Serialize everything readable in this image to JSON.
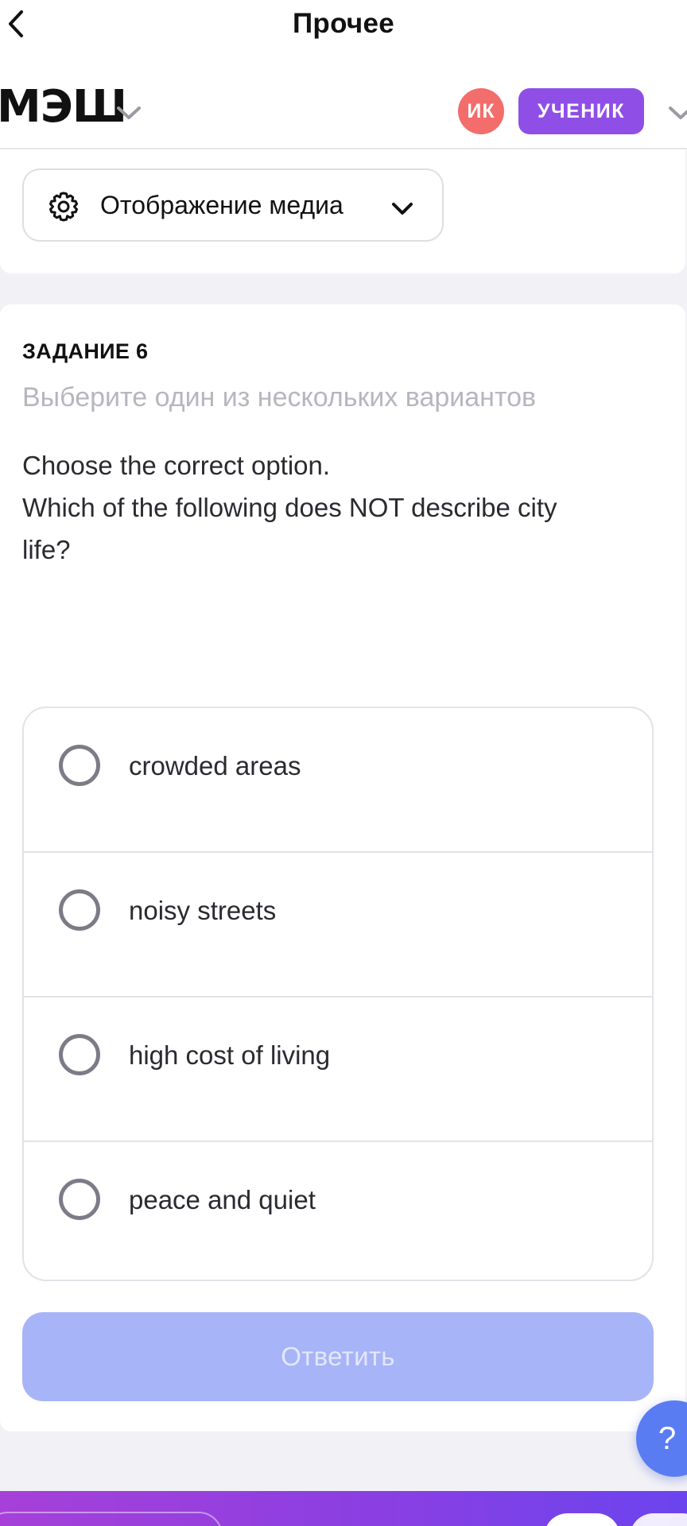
{
  "nav": {
    "title": "Прочее",
    "back_icon": "chevron-left-icon"
  },
  "header": {
    "logo_text": "МЭШ",
    "logo_dropdown_icon": "chevron-down-icon",
    "avatar_initials": "ИК",
    "avatar_color": "#f26d6b",
    "role_label": "УЧЕНИК",
    "role_color": "#8f4ee6",
    "profile_dropdown_icon": "chevron-down-icon"
  },
  "media": {
    "label": "Отображение медиа",
    "icon": "gear-icon",
    "dropdown_icon": "chevron-down-icon"
  },
  "task": {
    "heading": "ЗАДАНИЕ 6",
    "instruction": "Выберите один из нескольких вариантов",
    "question_lines": [
      "Choose the correct option.",
      "Which of the following does NOT describe city",
      "life?"
    ],
    "options": [
      {
        "label": "crowded areas",
        "selected": false
      },
      {
        "label": "noisy streets",
        "selected": false
      },
      {
        "label": "high cost of living",
        "selected": false
      },
      {
        "label": "peace and quiet",
        "selected": false
      }
    ],
    "submit_label": "Ответить",
    "submit_color": "#a7b4f8"
  },
  "help": {
    "label": "?",
    "color": "#5a7cf3"
  }
}
